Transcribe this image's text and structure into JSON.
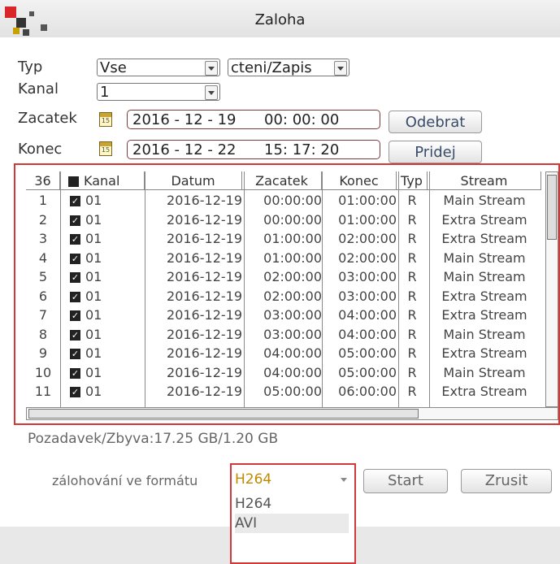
{
  "window": {
    "title": "Zaloha"
  },
  "form": {
    "typ_label": "Typ",
    "typ_value": "Vse",
    "mode_value": "cteni/Zapis",
    "kanal_label": "Kanal",
    "kanal_value": "1",
    "zacatek_label": "Zacatek",
    "zacatek_date": "2016 - 12 - 19",
    "zacatek_time": "00: 00: 00",
    "konec_label": "Konec",
    "konec_date": "2016 - 12 - 22",
    "konec_time": "15: 17: 20",
    "odebrat_label": "Odebrat",
    "pridej_label": "Pridej"
  },
  "table": {
    "headers": [
      "36",
      "Kanal",
      "Datum",
      "Zacatek",
      "Konec",
      "Typ",
      "Stream"
    ],
    "rows": [
      [
        "1",
        "01",
        "2016-12-19",
        "00:00:00",
        "01:00:00",
        "R",
        "Main Stream"
      ],
      [
        "2",
        "01",
        "2016-12-19",
        "00:00:00",
        "01:00:00",
        "R",
        "Extra Stream"
      ],
      [
        "3",
        "01",
        "2016-12-19",
        "01:00:00",
        "02:00:00",
        "R",
        "Extra Stream"
      ],
      [
        "4",
        "01",
        "2016-12-19",
        "01:00:00",
        "02:00:00",
        "R",
        "Main Stream"
      ],
      [
        "5",
        "01",
        "2016-12-19",
        "02:00:00",
        "03:00:00",
        "R",
        "Main Stream"
      ],
      [
        "6",
        "01",
        "2016-12-19",
        "02:00:00",
        "03:00:00",
        "R",
        "Extra Stream"
      ],
      [
        "7",
        "01",
        "2016-12-19",
        "03:00:00",
        "04:00:00",
        "R",
        "Extra Stream"
      ],
      [
        "8",
        "01",
        "2016-12-19",
        "03:00:00",
        "04:00:00",
        "R",
        "Main Stream"
      ],
      [
        "9",
        "01",
        "2016-12-19",
        "04:00:00",
        "05:00:00",
        "R",
        "Extra Stream"
      ],
      [
        "10",
        "01",
        "2016-12-19",
        "04:00:00",
        "05:00:00",
        "R",
        "Main Stream"
      ],
      [
        "11",
        "01",
        "2016-12-19",
        "05:00:00",
        "06:00:00",
        "R",
        "Extra Stream"
      ]
    ]
  },
  "status": {
    "text": "Pozadavek/Zbyva:17.25 GB/1.20 GB"
  },
  "export": {
    "format_label": "zálohování ve formátu",
    "selected": "H264",
    "options": [
      "H264",
      "AVI"
    ],
    "start_label": "Start",
    "zrusit_label": "Zrusit"
  },
  "colors": {
    "highlight_border": "#d23838",
    "selected_format": "#c08a00"
  }
}
